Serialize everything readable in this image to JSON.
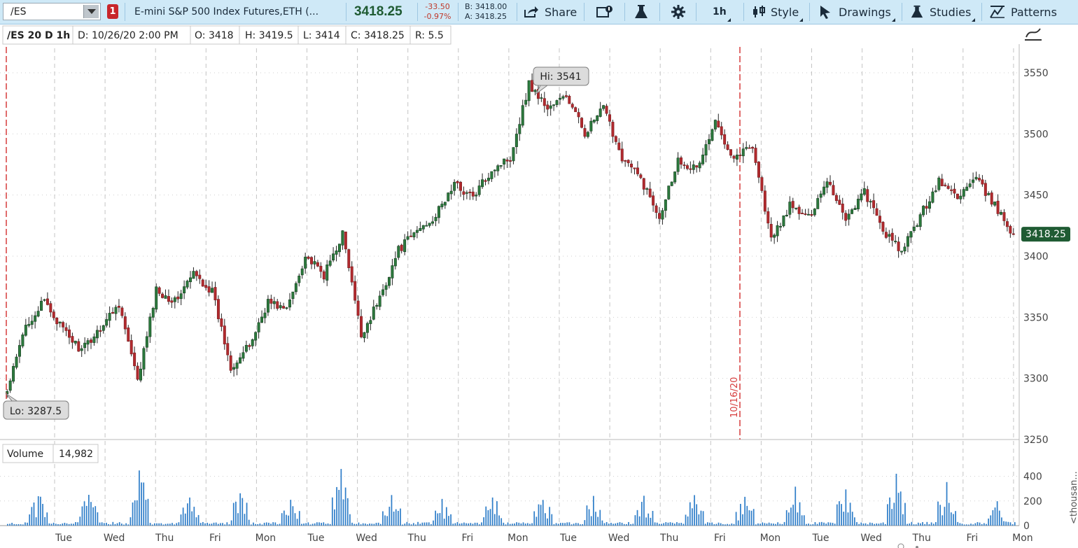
{
  "toolbar": {
    "symbol": "/ES",
    "alert_count": "1",
    "description": "E-mini S&P 500 Index Futures,ETH (...",
    "last_price": "3418.25",
    "change": "-33.50",
    "change_pct": "-0.97%",
    "bid": "B: 3418.00",
    "ask": "A: 3418.25",
    "share_label": "Share",
    "timeframe": "1h",
    "style_label": "Style",
    "drawings_label": "Drawings",
    "studies_label": "Studies",
    "patterns_label": "Patterns"
  },
  "colors": {
    "up": "#1e5e2e",
    "down": "#b22a2e",
    "volume": "#2f7ec9",
    "price_badge": "#1f5b33",
    "accent_red": "#d63c3c",
    "toolbar_bg": "#cfe9f7"
  },
  "icons": {
    "symbol_dropdown": "chevron-down-icon",
    "share": "share-icon",
    "detach": "detach-icon",
    "flask": "flask-icon",
    "settings": "gear-icon",
    "style": "candlestick-icon",
    "drawings": "cursor-icon",
    "studies": "flask-icon",
    "patterns": "pattern-icon",
    "style_panel": "chart-style-icon"
  },
  "header": {
    "chart_label": "/ES 20 D 1h",
    "date": "D: 10/26/20 2:00 PM",
    "open": "O: 3418",
    "high": "H: 3419.5",
    "low": "L: 3414",
    "close": "C: 3418.25",
    "range": "R: 5.5"
  },
  "volume_header": {
    "label": "Volume",
    "value": "14,982"
  },
  "chart_data": {
    "type": "candlestick",
    "ylim": [
      3250,
      3570
    ],
    "yticks": [
      3250,
      3300,
      3350,
      3400,
      3450,
      3500,
      3550
    ],
    "last_price": 3418.25,
    "last_price_label": "3418.25",
    "hi_label": "Hi: 3541",
    "lo_label": "Lo: 3287.5",
    "marker_label": "10/16/20",
    "xlabels": [
      "Tue",
      "Wed",
      "Thu",
      "Fri",
      "Mon",
      "Tue",
      "Wed",
      "Thu",
      "Fri",
      "Mon",
      "Tue",
      "Wed",
      "Thu",
      "Fri",
      "Mon",
      "Tue",
      "Wed",
      "Thu",
      "Fri",
      "Mon"
    ],
    "path_points": [
      [
        3287.5,
        3290
      ],
      [
        3342,
        3345
      ],
      [
        3362,
        3364
      ],
      [
        3338,
        3341
      ],
      [
        3320,
        3325
      ],
      [
        3340,
        3343
      ],
      [
        3360,
        3363
      ],
      [
        3296,
        3298
      ],
      [
        3372,
        3373
      ],
      [
        3362,
        3364
      ],
      [
        3385,
        3386
      ],
      [
        3370,
        3372
      ],
      [
        3309,
        3310
      ],
      [
        3325,
        3328
      ],
      [
        3362,
        3364
      ],
      [
        3355,
        3357
      ],
      [
        3400,
        3401
      ],
      [
        3383,
        3385
      ],
      [
        3418,
        3419
      ],
      [
        3334,
        3336
      ],
      [
        3365,
        3367
      ],
      [
        3404,
        3406
      ],
      [
        3420,
        3422
      ],
      [
        3432,
        3434
      ],
      [
        3458,
        3460
      ],
      [
        3447,
        3449
      ],
      [
        3470,
        3472
      ],
      [
        3480,
        3482
      ],
      [
        3541,
        3541
      ],
      [
        3520,
        3522
      ],
      [
        3530,
        3532
      ],
      [
        3500,
        3502
      ],
      [
        3520,
        3522
      ],
      [
        3480,
        3482
      ],
      [
        3462,
        3464
      ],
      [
        3432,
        3434
      ],
      [
        3478,
        3480
      ],
      [
        3470,
        3472
      ],
      [
        3508,
        3510
      ],
      [
        3480,
        3482
      ],
      [
        3490,
        3492
      ],
      [
        3412,
        3414
      ],
      [
        3440,
        3442
      ],
      [
        3430,
        3432
      ],
      [
        3462,
        3464
      ],
      [
        3430,
        3432
      ],
      [
        3452,
        3454
      ],
      [
        3420,
        3422
      ],
      [
        3402,
        3404
      ],
      [
        3432,
        3434
      ],
      [
        3460,
        3462
      ],
      [
        3448,
        3450
      ],
      [
        3462,
        3464
      ],
      [
        3440,
        3442
      ],
      [
        3418.25,
        3418.25
      ]
    ],
    "volume": {
      "ylim": [
        0,
        500
      ],
      "yticks": [
        0,
        200,
        400
      ],
      "axis_label": "<thousan...",
      "peaks": [
        270,
        260,
        480,
        250,
        280,
        220,
        460,
        250,
        250,
        260,
        240,
        280,
        250,
        270,
        250,
        350,
        330,
        480,
        370,
        200
      ]
    }
  }
}
